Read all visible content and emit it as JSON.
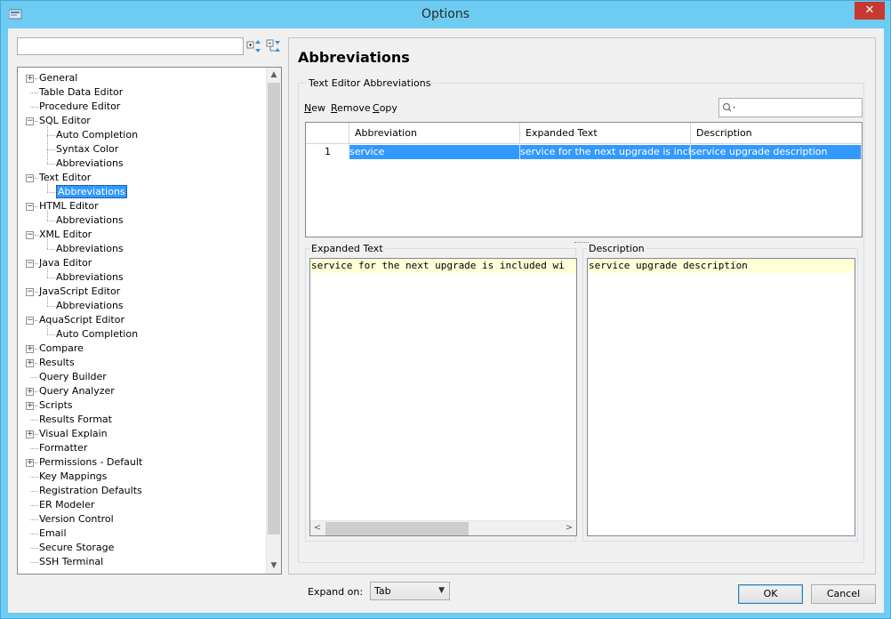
{
  "window": {
    "title": "Options",
    "close_glyph": "✕"
  },
  "tree": {
    "items": [
      {
        "label": "General",
        "level": 0,
        "expander": "+"
      },
      {
        "label": "Table Data Editor",
        "level": 0,
        "expander": ""
      },
      {
        "label": "Procedure Editor",
        "level": 0,
        "expander": ""
      },
      {
        "label": "SQL Editor",
        "level": 0,
        "expander": "-"
      },
      {
        "label": "Auto Completion",
        "level": 1,
        "expander": ""
      },
      {
        "label": "Syntax Color",
        "level": 1,
        "expander": ""
      },
      {
        "label": "Abbreviations",
        "level": 1,
        "expander": ""
      },
      {
        "label": "Text Editor",
        "level": 0,
        "expander": "-"
      },
      {
        "label": "Abbreviations",
        "level": 1,
        "expander": "",
        "selected": true
      },
      {
        "label": "HTML Editor",
        "level": 0,
        "expander": "-"
      },
      {
        "label": "Abbreviations",
        "level": 1,
        "expander": ""
      },
      {
        "label": "XML Editor",
        "level": 0,
        "expander": "-"
      },
      {
        "label": "Abbreviations",
        "level": 1,
        "expander": ""
      },
      {
        "label": "Java Editor",
        "level": 0,
        "expander": "-"
      },
      {
        "label": "Abbreviations",
        "level": 1,
        "expander": ""
      },
      {
        "label": "JavaScript Editor",
        "level": 0,
        "expander": "-"
      },
      {
        "label": "Abbreviations",
        "level": 1,
        "expander": ""
      },
      {
        "label": "AquaScript Editor",
        "level": 0,
        "expander": "-"
      },
      {
        "label": "Auto Completion",
        "level": 1,
        "expander": ""
      },
      {
        "label": "Compare",
        "level": 0,
        "expander": "+"
      },
      {
        "label": "Results",
        "level": 0,
        "expander": "+"
      },
      {
        "label": "Query Builder",
        "level": 0,
        "expander": ""
      },
      {
        "label": "Query Analyzer",
        "level": 0,
        "expander": "+"
      },
      {
        "label": "Scripts",
        "level": 0,
        "expander": "+"
      },
      {
        "label": "Results Format",
        "level": 0,
        "expander": ""
      },
      {
        "label": "Visual Explain",
        "level": 0,
        "expander": "+"
      },
      {
        "label": "Formatter",
        "level": 0,
        "expander": ""
      },
      {
        "label": "Permissions - Default",
        "level": 0,
        "expander": "+"
      },
      {
        "label": "Key Mappings",
        "level": 0,
        "expander": ""
      },
      {
        "label": "Registration Defaults",
        "level": 0,
        "expander": ""
      },
      {
        "label": "ER Modeler",
        "level": 0,
        "expander": ""
      },
      {
        "label": "Version Control",
        "level": 0,
        "expander": ""
      },
      {
        "label": "Email",
        "level": 0,
        "expander": ""
      },
      {
        "label": "Secure Storage",
        "level": 0,
        "expander": ""
      },
      {
        "label": "SSH Terminal",
        "level": 0,
        "expander": ""
      }
    ]
  },
  "panel": {
    "heading": "Abbreviations",
    "group_label": "Text Editor Abbreviations",
    "new_label": "New",
    "remove_label": "Remove",
    "copy_label": "Copy",
    "new_mnemonic": "N",
    "new_rest": "ew",
    "remove_mnemonic": "R",
    "remove_rest": "emove",
    "copy_mnemonic": "C",
    "copy_rest": "opy"
  },
  "grid": {
    "columns": [
      "Abbreviation",
      "Expanded Text",
      "Description"
    ],
    "rows": [
      {
        "num": "1",
        "abbreviation": "service",
        "expanded": "service for the next upgrade is inclu...",
        "description": "service upgrade description"
      }
    ]
  },
  "expanded_text": {
    "label": "Expanded Text",
    "value": "service for the next upgrade is included wi"
  },
  "description": {
    "label": "Description",
    "value": "service upgrade description"
  },
  "expand_on": {
    "label": "Expand on:",
    "value": "Tab"
  },
  "buttons": {
    "ok": "OK",
    "cancel": "Cancel"
  },
  "colors": {
    "selection": "#3399ff",
    "editor_line": "#ffffd8",
    "close": "#c7392e",
    "frame": "#6ecbf2"
  }
}
